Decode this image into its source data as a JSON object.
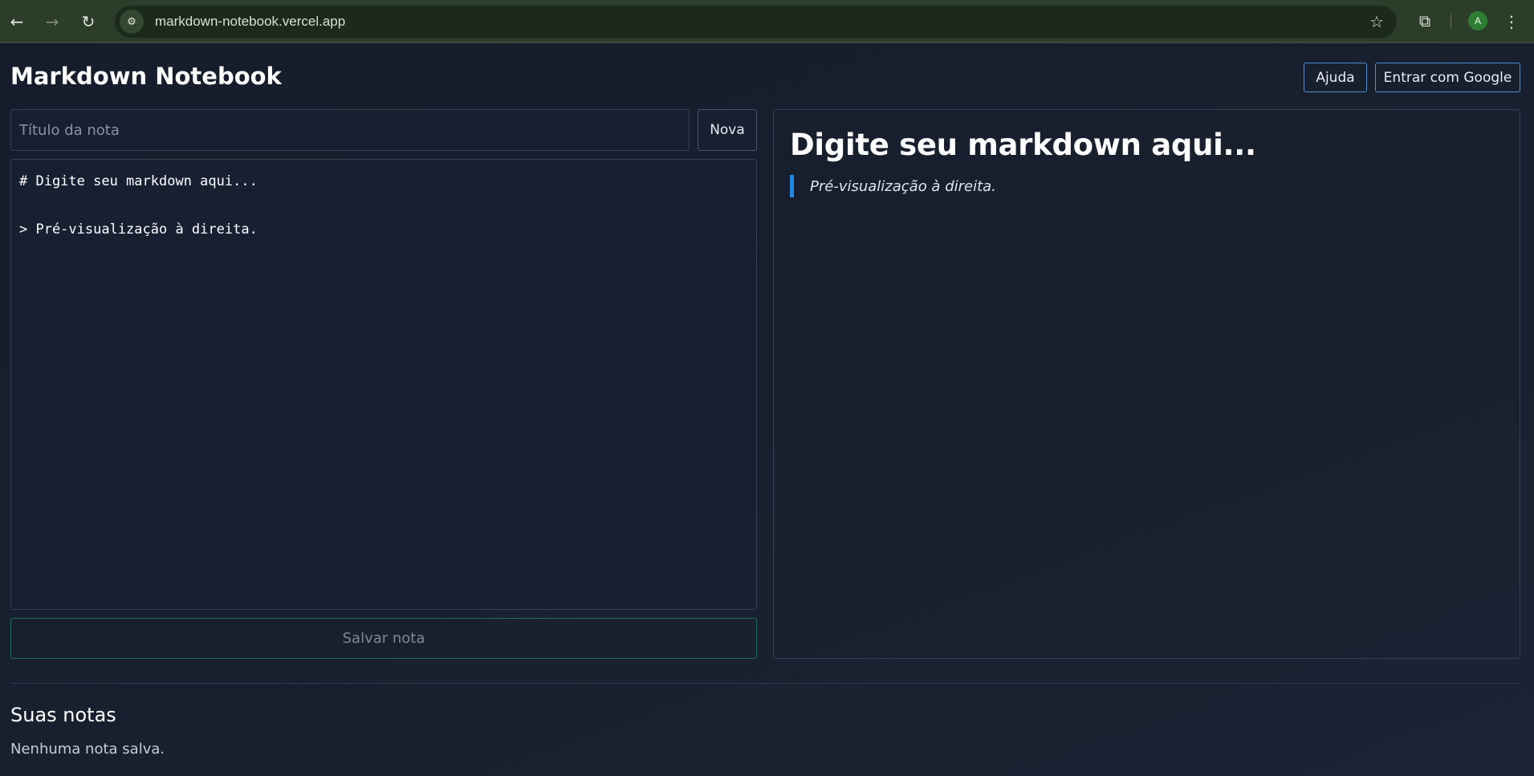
{
  "browser": {
    "url": "markdown-notebook.vercel.app",
    "avatar_letter": "A",
    "icons": [
      "back-arrow-icon",
      "forward-arrow-icon",
      "reload-icon",
      "site-settings-icon",
      "star-icon",
      "extensions-icon",
      "kebab-menu-icon"
    ]
  },
  "header": {
    "title": "Markdown Notebook",
    "help_label": "Ajuda",
    "login_label": "Entrar com Google"
  },
  "editor": {
    "title_placeholder": "Título da nota",
    "new_label": "Nova",
    "lines": [
      "# Digite seu markdown aqui...",
      "",
      "> Pré-visualização à direita."
    ],
    "save_label": "Salvar nota"
  },
  "preview": {
    "heading": "Digite seu markdown aqui...",
    "quote": "Pré-visualização à direita."
  },
  "notes": {
    "title": "Suas notas",
    "empty_message": "Nenhuma nota salva."
  },
  "colors": {
    "background": "#18202f",
    "accent_blue": "#1e88e5",
    "save_border": "#1f6b62"
  }
}
